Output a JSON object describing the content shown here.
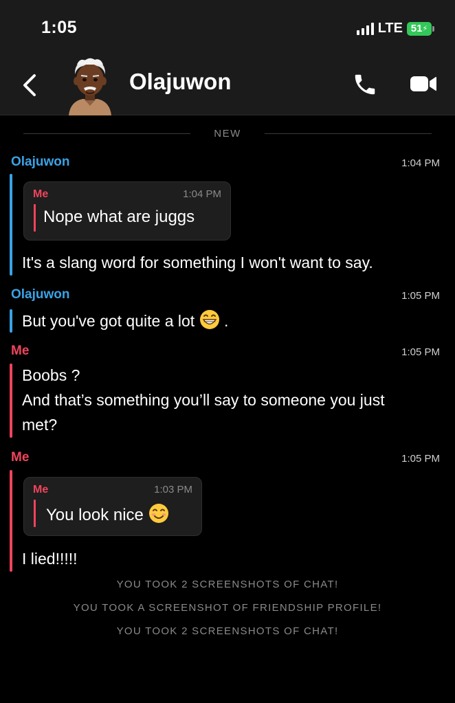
{
  "status_bar": {
    "time": "1:05",
    "network": "LTE",
    "battery": "51"
  },
  "header": {
    "contact_name": "Olajuwon"
  },
  "divider": {
    "label": "NEW"
  },
  "messages": [
    {
      "sender": "Olajuwon",
      "time": "1:04 PM",
      "quote": {
        "sender": "Me",
        "time": "1:04 PM",
        "text": "Nope what are juggs"
      },
      "text": "It's a slang word for something I won't want to say."
    },
    {
      "sender": "Olajuwon",
      "time": "1:05 PM",
      "text": "But you've got quite a lot",
      "text_suffix": ".",
      "emoji": "grinning-face-emoji"
    },
    {
      "sender": "Me",
      "time": "1:05 PM",
      "lines": [
        "Boobs ?",
        "And that’s something you’ll say to someone you just",
        "met?"
      ]
    },
    {
      "sender": "Me",
      "time": "1:05 PM",
      "quote": {
        "sender": "Me",
        "time": "1:03 PM",
        "text": "You look nice",
        "emoji": "smiling-face-emoji"
      },
      "text": "I lied!!!!!"
    }
  ],
  "system_notices": [
    "YOU TOOK 2 SCREENSHOTS OF CHAT!",
    "YOU TOOK A SCREENSHOT OF FRIENDSHIP PROFILE!",
    "YOU TOOK 2 SCREENSHOTS OF CHAT!"
  ],
  "colors": {
    "them": "#3aa3e6",
    "me": "#f0445c",
    "battery": "#34c759"
  }
}
